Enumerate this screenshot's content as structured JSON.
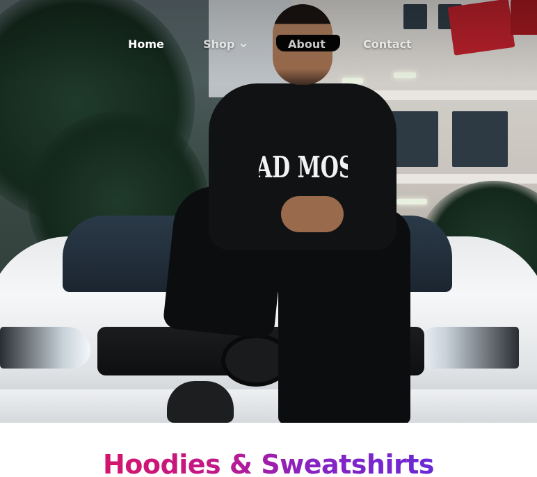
{
  "nav": {
    "items": [
      {
        "label": "Home",
        "active": true
      },
      {
        "label": "Shop",
        "has_dropdown": true
      },
      {
        "label": "About"
      },
      {
        "label": "Contact"
      }
    ]
  },
  "hero": {
    "hoodie_print": "BAD MOSS"
  },
  "section": {
    "title": "Hoodies & Sweatshirts"
  },
  "colors": {
    "title_gradient_start": "#d4146b",
    "title_gradient_end": "#6a2ad6",
    "nav_text": "#ffffff"
  },
  "icons": {
    "shop_dropdown": "chevron-down-icon"
  }
}
